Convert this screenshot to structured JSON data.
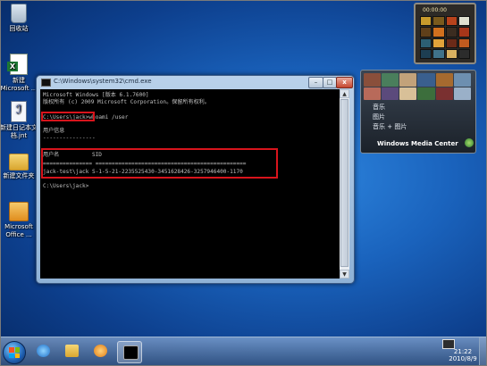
{
  "desktop": {
    "icons": [
      {
        "label": "回收站",
        "icon": "recycle-bin-icon"
      },
      {
        "label": "新建\nMicrosoft ...",
        "icon": "excel-file-icon"
      },
      {
        "label": "新建日记本文\n档.jnt",
        "icon": "journal-document-icon"
      },
      {
        "label": "新建文件夹",
        "icon": "folder-icon"
      },
      {
        "label": "Microsoft\nOffice ...",
        "icon": "office-icon"
      }
    ]
  },
  "cmd_window": {
    "title": "C:\\Windows\\system32\\cmd.exe",
    "controls": {
      "minimize": "–",
      "maximize": "□",
      "close": "x"
    },
    "lines": [
      "Microsoft Windows [版本 6.1.7600]",
      "版权所有 (c) 2009 Microsoft Corporation。保留所有权利。",
      "",
      "C:\\Users\\jack>whoami /user",
      "",
      "用户信息",
      "----------------",
      "",
      "用户名          SID",
      "=============== ==============================================",
      "jack-test\\jack S-1-5-21-2235525430-3451628426-3257946400-1170",
      "",
      "C:\\Users\\jack>"
    ],
    "scroll_up": "▲",
    "scroll_down": "▼"
  },
  "gadgets": {
    "puzzle_clock": "00:00:00",
    "media_center": {
      "items": [
        "音乐",
        "图片",
        "音乐 + 图片"
      ],
      "label": "Windows Media Center"
    }
  },
  "taskbar": {
    "pinned": [
      "start-button",
      "internet-explorer",
      "windows-explorer",
      "media-player",
      "command-prompt"
    ],
    "clock_time": "21:22",
    "clock_date": "2010/8/9"
  },
  "colors": {
    "highlight": "#d8141c",
    "console_bg": "#000000",
    "console_text": "#c0c0c0",
    "desktop_blue": "#1a63bd"
  }
}
